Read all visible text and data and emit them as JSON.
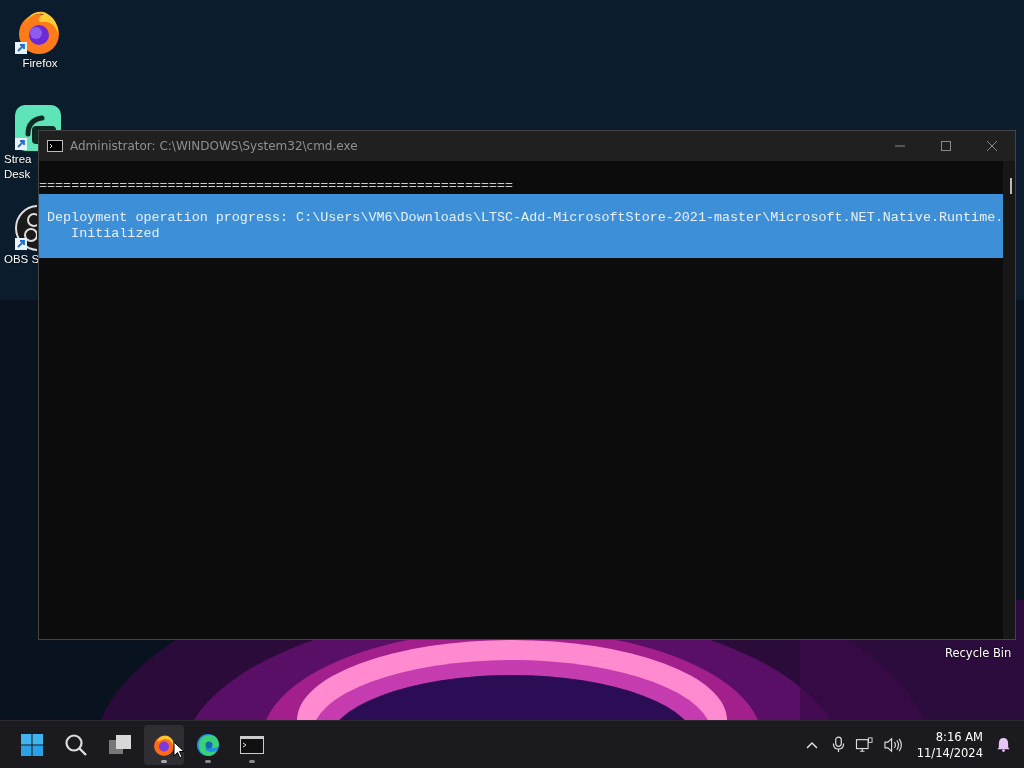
{
  "desktop_icons": [
    {
      "kind": "firefox",
      "label_lines": [
        "Firefox"
      ]
    },
    {
      "kind": "stream",
      "label_lines": [
        "Strea",
        "Desk"
      ]
    },
    {
      "kind": "obs",
      "label_lines": [
        "OBS S"
      ]
    }
  ],
  "recycle_bin": {
    "label": "Recycle Bin"
  },
  "window": {
    "title": "Administrator: C:\\WINDOWS\\System32\\cmd.exe",
    "console": [
      {
        "selected": false,
        "lines": [
          "==========================================================="
        ]
      },
      {
        "selected": true,
        "lines": [
          "Deployment operation progress: C:\\Users\\VM6\\Downloads\\LTSC-Add-MicrosoftStore-2021-master\\Microsoft.NET.Native.Runtime.",
          "   Initialized"
        ]
      }
    ]
  },
  "taskbar": {
    "items": [
      {
        "kind": "start",
        "running": false,
        "active": false
      },
      {
        "kind": "search",
        "running": false,
        "active": false
      },
      {
        "kind": "taskview",
        "running": false,
        "active": false
      },
      {
        "kind": "firefox",
        "running": true,
        "active": true
      },
      {
        "kind": "edge",
        "running": true,
        "active": false
      },
      {
        "kind": "terminal",
        "running": true,
        "active": false
      }
    ],
    "clock": {
      "time": "8:16 AM",
      "date": "11/14/2024"
    }
  }
}
